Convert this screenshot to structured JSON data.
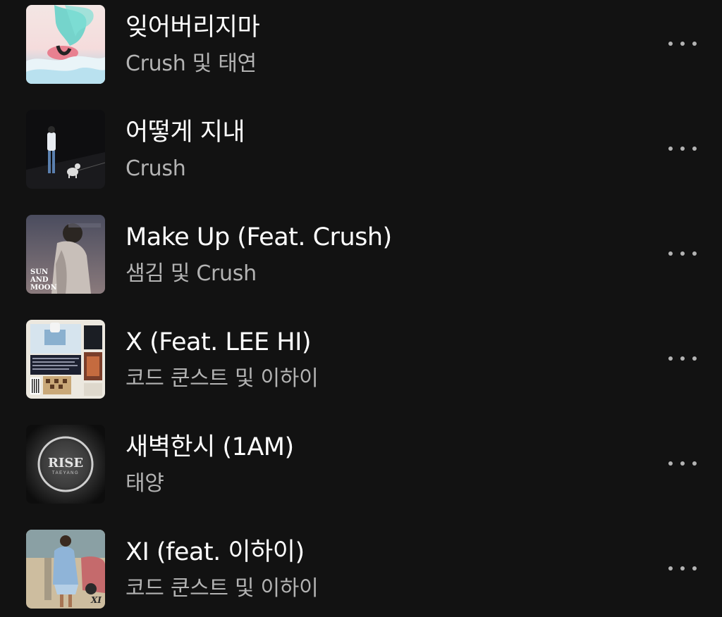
{
  "tracks": [
    {
      "title": "잊어버리지마",
      "artist": "Crush 및 태연",
      "cover_icon": "album-cover-clouds"
    },
    {
      "title": "어떻게 지내",
      "artist": "Crush",
      "cover_icon": "album-cover-night-road"
    },
    {
      "title": "Make Up (Feat. Crush)",
      "artist": "샘김 및 Crush",
      "cover_icon": "album-cover-sun-and-moon",
      "cover_text": [
        "SUN",
        "AND",
        "MOON"
      ]
    },
    {
      "title": "X (Feat. LEE HI)",
      "artist": "코드 쿤스트 및 이하이",
      "cover_icon": "album-cover-collage"
    },
    {
      "title": "새벽한시 (1AM)",
      "artist": "태양",
      "cover_icon": "album-cover-rise",
      "cover_text": [
        "RISE",
        "TAEYANG"
      ]
    },
    {
      "title": "XI (feat. 이하이)",
      "artist": "코드 쿤스트 및 이하이",
      "cover_icon": "album-cover-street",
      "cover_text": [
        "XI"
      ]
    }
  ],
  "more_button_icon": "more-dots-icon",
  "colors": {
    "background": "#121212",
    "title": "#ffffff",
    "subtitle": "#b3b3b3"
  }
}
